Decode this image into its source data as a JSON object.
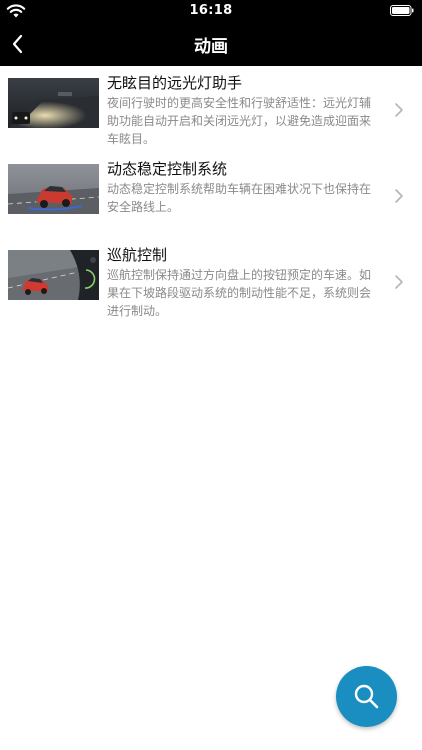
{
  "status_bar": {
    "time": "16:18",
    "wifi_icon": "wifi-icon",
    "battery_icon": "battery-icon"
  },
  "nav": {
    "title": "动画",
    "back_icon": "chevron-left-icon"
  },
  "items": [
    {
      "title": "无眩目的远光灯助手",
      "description": "夜间行驶时的更高安全性和行驶舒适性：远光灯辅助功能自动开启和关闭远光灯，以避免造成迎面来车眩目。",
      "thumbnail": "night-road-thumbnail"
    },
    {
      "title": "动态稳定控制系统",
      "description": "动态稳定控制系统帮助车辆在困难状况下也保持在安全路线上。",
      "thumbnail": "red-car-thumbnail"
    },
    {
      "title": "巡航控制",
      "description": "巡航控制保持通过方向盘上的按钮预定的车速。如果在下坡路段驱动系统的制动性能不足，系统则会进行制动。",
      "thumbnail": "cruise-control-thumbnail"
    }
  ],
  "fab": {
    "icon": "search-icon",
    "color": "#1a8ec0"
  }
}
